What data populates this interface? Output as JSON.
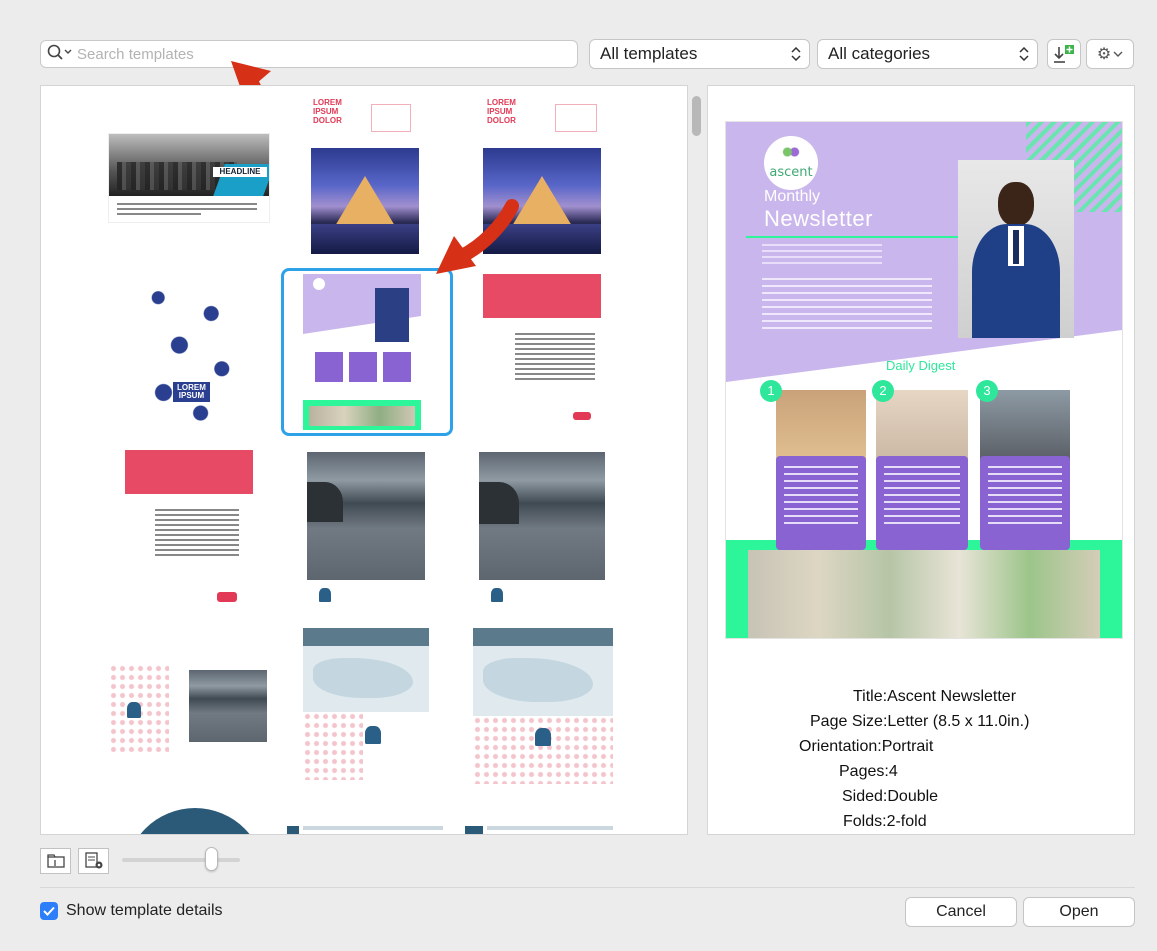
{
  "toolbar": {
    "search_placeholder": "Search templates",
    "templates_filter": "All templates",
    "categories_filter": "All categories",
    "updown_glyph": "⌃⌄"
  },
  "thumbnails": {
    "headline": "HEADLINE",
    "lorem_red": [
      "LOREM",
      "IPSUM",
      "DOLOR"
    ],
    "lorem_blue": [
      "LOREM",
      "IPSUM"
    ]
  },
  "preview": {
    "brand": "ascent",
    "kicker": "Monthly",
    "title": "Newsletter",
    "section": "Daily Digest",
    "steps": [
      "1",
      "2",
      "3"
    ]
  },
  "details": {
    "title_label": "Title:",
    "title_value": "Ascent Newsletter",
    "pagesize_label": "Page Size:",
    "pagesize_value": "Letter (8.5 x 11.0in.)",
    "orientation_label": "Orientation:",
    "orientation_value": "Portrait",
    "pages_label": "Pages:",
    "pages_value": "4",
    "sided_label": "Sided:",
    "sided_value": "Double",
    "folds_label": "Folds:",
    "folds_value": "2-fold"
  },
  "footer": {
    "show_details_label": "Show template details",
    "show_details_checked": true,
    "cancel_label": "Cancel",
    "open_label": "Open",
    "zoom_level": 0.76
  },
  "colors": {
    "accent": "#2d7ff9",
    "selection": "#2ea2e8",
    "annotation_arrow": "#d63016",
    "lavender": "#c9b6ec",
    "mint": "#2cf59a",
    "purple_card": "#8a63d2"
  }
}
